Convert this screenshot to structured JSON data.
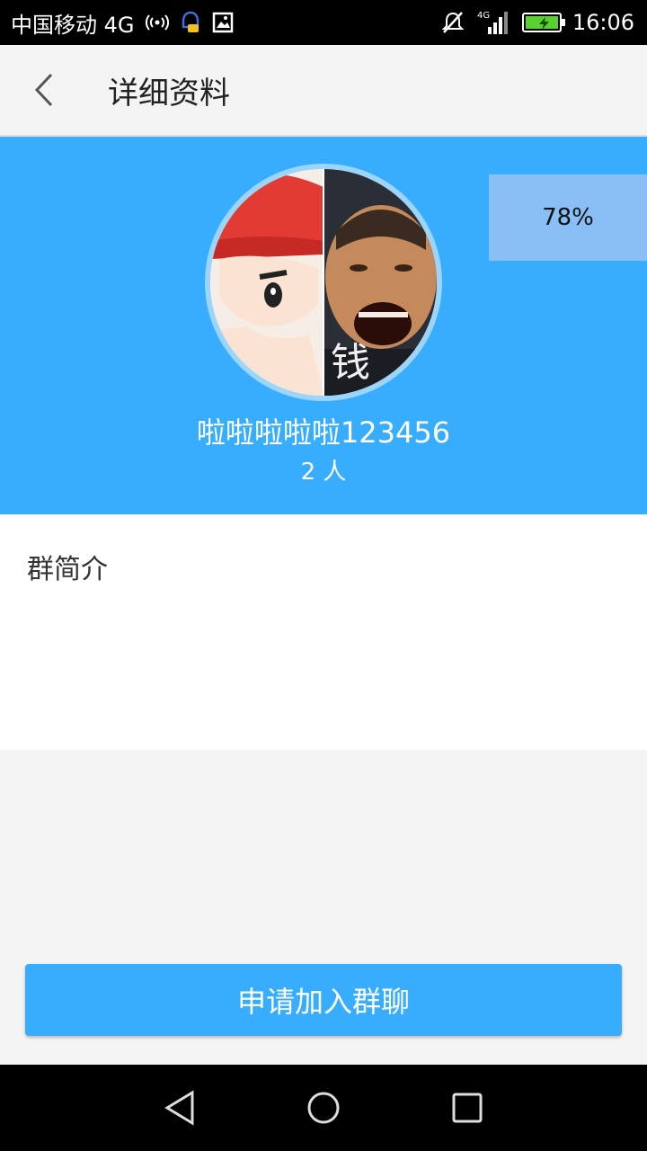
{
  "status_bar": {
    "carrier": "中国移动 4G",
    "network_small": "4G",
    "time": "16:06",
    "icons": [
      "hotspot-icon",
      "qq-notification-icon",
      "gallery-icon",
      "mute-icon",
      "signal-icon",
      "battery-icon"
    ],
    "battery_color": "#5bd12f"
  },
  "title_bar": {
    "title": "详细资料",
    "back_icon": "chevron-left-icon"
  },
  "header": {
    "background": "#38adfe",
    "group_name": "啦啦啦啦啦123456",
    "member_count": "2 人",
    "progress_label": "78%",
    "progress": 0.78,
    "avatar_overlay_text": "钱"
  },
  "intro": {
    "label": "群简介"
  },
  "actions": {
    "join_label": "申请加入群聊"
  },
  "nav_bar": {
    "icons": [
      "back-triangle-icon",
      "home-circle-icon",
      "recents-square-icon"
    ]
  }
}
